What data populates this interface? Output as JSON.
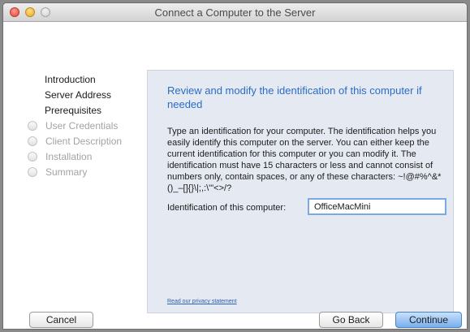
{
  "window": {
    "title": "Connect a Computer to the Server"
  },
  "steps": [
    {
      "label": "Introduction",
      "state": "completed"
    },
    {
      "label": "Server Address",
      "state": "completed"
    },
    {
      "label": "Prerequisites",
      "state": "current"
    },
    {
      "label": "User Credentials",
      "state": "pending"
    },
    {
      "label": "Client Description",
      "state": "pending"
    },
    {
      "label": "Installation",
      "state": "pending"
    },
    {
      "label": "Summary",
      "state": "pending"
    }
  ],
  "panel": {
    "heading": "Review and modify the identification of this computer if needed",
    "body": "Type an identification for your computer. The identification helps you easily identify this computer on the server. You can either keep the current identification for this computer or you can modify it. The identification must have 15 characters or less and cannot consist of numbers only, contain spaces, or any of these characters: ~!@#%^&*()_–[]{}\\|;,:\\'\"<>/?",
    "field_label": "Identification of this computer:",
    "field_value": "OfficeMacMini",
    "privacy_link": "Read our privacy statement"
  },
  "buttons": {
    "cancel": "Cancel",
    "back": "Go Back",
    "continue": "Continue"
  }
}
